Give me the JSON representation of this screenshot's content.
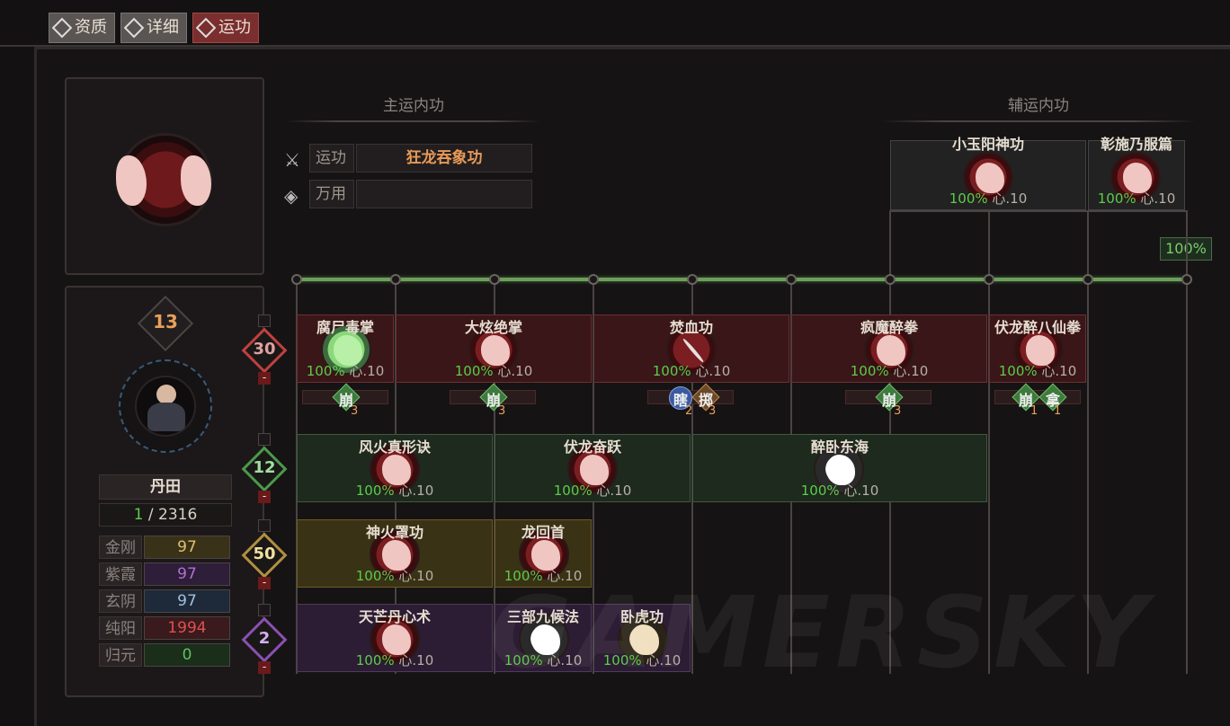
{
  "tabs": [
    {
      "label": "资质",
      "active": false
    },
    {
      "label": "详细",
      "active": false
    },
    {
      "label": "运功",
      "active": true
    }
  ],
  "profile": {
    "level": "13",
    "dantian_label": "丹田",
    "dantian_current": "1",
    "dantian_max": "/ 2316"
  },
  "stats": [
    {
      "label": "金刚",
      "value": "97",
      "color": "#e0c070"
    },
    {
      "label": "紫霞",
      "value": "97",
      "color": "#b070d0"
    },
    {
      "label": "玄阴",
      "value": "97",
      "color": "#a0c0e0"
    },
    {
      "label": "纯阳",
      "value": "1994",
      "color": "#e05050"
    },
    {
      "label": "归元",
      "value": "0",
      "color": "#60c060"
    }
  ],
  "main_section": {
    "title": "主运内功",
    "run_label": "运功",
    "run_value": "狂龙吞象功",
    "universal_label": "万用",
    "universal_value": ""
  },
  "aux_section": {
    "title": "辅运内功",
    "skills": [
      {
        "name": "小玉阳神功",
        "pct": "100%",
        "xin": "心.10"
      },
      {
        "name": "彰施乃服篇",
        "pct": "100%",
        "xin": "心.10"
      }
    ],
    "pct_badge": "100%"
  },
  "row_levels": [
    {
      "value": "30",
      "color": "#c04040"
    },
    {
      "value": "12",
      "color": "#4a9a4a"
    },
    {
      "value": "50",
      "color": "#b09040"
    },
    {
      "value": "2",
      "color": "#8a50b0"
    }
  ],
  "rows": {
    "row1": [
      {
        "name": "腐尸毒掌",
        "pct": "100%",
        "xin": "心.10"
      },
      {
        "name": "大炫绝掌",
        "pct": "100%",
        "xin": "心.10"
      },
      {
        "name": "焚血功",
        "pct": "100%",
        "xin": "心.10"
      },
      {
        "name": "疯魔醉拳",
        "pct": "100%",
        "xin": "心.10"
      },
      {
        "name": "伏龙醉八仙拳",
        "pct": "100%",
        "xin": "心.10"
      }
    ],
    "row2": [
      {
        "name": "风火真形诀",
        "pct": "100%",
        "xin": "心.10"
      },
      {
        "name": "伏龙奋跃",
        "pct": "100%",
        "xin": "心.10"
      },
      {
        "name": "醉卧东海",
        "pct": "100%",
        "xin": "心.10"
      }
    ],
    "row3": [
      {
        "name": "神火罩功",
        "pct": "100%",
        "xin": "心.10"
      },
      {
        "name": "龙回首",
        "pct": "100%",
        "xin": "心.10"
      }
    ],
    "row4": [
      {
        "name": "天芒丹心术",
        "pct": "100%",
        "xin": "心.10"
      },
      {
        "name": "三部九候法",
        "pct": "100%",
        "xin": "心.10"
      },
      {
        "name": "卧虎功",
        "pct": "100%",
        "xin": "心.10"
      }
    ]
  },
  "tags": [
    {
      "text": "崩",
      "num": "3"
    },
    {
      "text": "崩",
      "num": "3"
    },
    {
      "text1": "瞎",
      "num1": "2",
      "text2": "掷",
      "num2": "3"
    },
    {
      "text": "崩",
      "num": "3"
    },
    {
      "text1": "崩",
      "num1": "1",
      "text2": "拿",
      "num2": "1"
    }
  ],
  "watermark": "GAMERSKY"
}
